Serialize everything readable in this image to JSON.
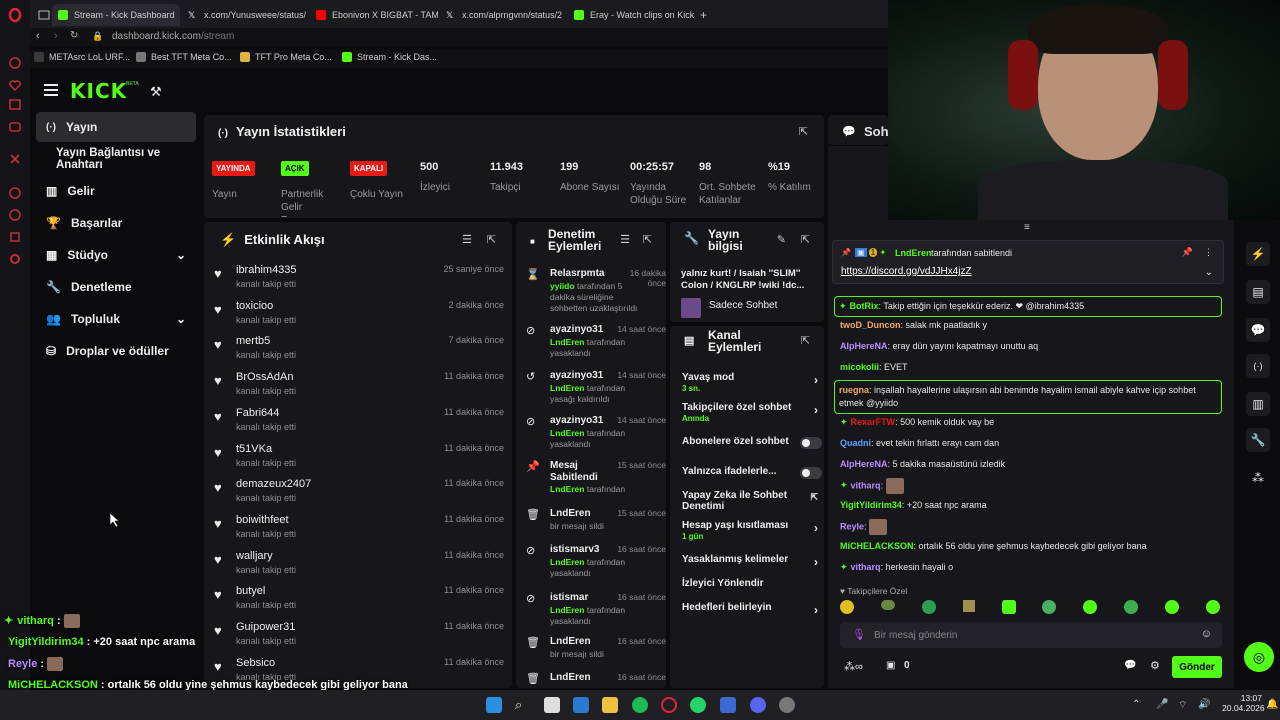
{
  "browser": {
    "tabs": [
      {
        "title": "Stream - Kick Dashboard",
        "color": "#53fc18"
      },
      {
        "title": "x.com/Yunusweee/status/",
        "color": "#ffffff"
      },
      {
        "title": "Ebonivon X BIGBAT - TAM",
        "color": "#ff0000"
      },
      {
        "title": "x.com/alprngvnn/status/2",
        "color": "#ffffff"
      },
      {
        "title": "Eray - Watch clips on Kick",
        "color": "#53fc18"
      }
    ],
    "url_host": "dashboard.kick.com",
    "url_path": "/stream",
    "bookmarks": [
      "METAsrc LoL URF...",
      "Best TFT Meta Co...",
      "TFT Pro Meta Co...",
      "Stream - Kick Das..."
    ]
  },
  "kick": {
    "logo": "KICK",
    "logo_sup": "BETA",
    "sidebar": [
      {
        "label": "Yayın",
        "icon": "broadcast-icon",
        "selected": true
      },
      {
        "label": "Yayın Bağlantısı ve Anahtarı",
        "icon": ""
      },
      {
        "label": "Gelir",
        "icon": "revenue-icon"
      },
      {
        "label": "Başarılar",
        "icon": "trophy-icon"
      },
      {
        "label": "Stüdyo",
        "icon": "studio-icon",
        "chevron": true
      },
      {
        "label": "Denetleme",
        "icon": "wrench-icon"
      },
      {
        "label": "Topluluk",
        "icon": "community-icon",
        "chevron": true
      },
      {
        "label": "Droplar ve ödüller",
        "icon": "drops-icon"
      }
    ]
  },
  "stats": {
    "title": "Yayın İstatistikleri",
    "items": [
      {
        "value": "YAYINDA",
        "label": "Yayın",
        "badge": "#e91916"
      },
      {
        "value": "AÇIK",
        "label": "Partnerlik Gelir Programı",
        "badge": "#53fc18"
      },
      {
        "value": "KAPALI",
        "label": "Çoklu Yayın",
        "badge": "#e91916"
      },
      {
        "value": "500",
        "label": "İzleyici"
      },
      {
        "value": "11.943",
        "label": "Takipçi"
      },
      {
        "value": "199",
        "label": "Abone Sayısı"
      },
      {
        "value": "00:25:57",
        "label": "Yayında Olduğu Süre"
      },
      {
        "value": "98",
        "label": "Ort. Sohbete Katılanlar"
      },
      {
        "value": "%19",
        "label": "% Katılım"
      }
    ]
  },
  "activity": {
    "title": "Etkinlik Akışı",
    "items": [
      {
        "name": "ibrahim4335",
        "sub": "kanalı takip etti",
        "time": "25 saniye önce"
      },
      {
        "name": "toxicioo",
        "sub": "kanalı takip etti",
        "time": "2 dakika önce"
      },
      {
        "name": "mertb5",
        "sub": "kanalı takip etti",
        "time": "7 dakika önce"
      },
      {
        "name": "BrOssAdAn",
        "sub": "kanalı takip etti",
        "time": "11 dakika önce"
      },
      {
        "name": "Fabri644",
        "sub": "kanalı takip etti",
        "time": "11 dakika önce"
      },
      {
        "name": "t51VKa",
        "sub": "kanalı takip etti",
        "time": "11 dakika önce"
      },
      {
        "name": "demazeux2407",
        "sub": "kanalı takip etti",
        "time": "11 dakika önce"
      },
      {
        "name": "boiwithfeet",
        "sub": "kanalı takip etti",
        "time": "11 dakika önce"
      },
      {
        "name": "walljary",
        "sub": "kanalı takip etti",
        "time": "11 dakika önce"
      },
      {
        "name": "butyel",
        "sub": "kanalı takip etti",
        "time": "11 dakika önce"
      },
      {
        "name": "Guipower31",
        "sub": "kanalı takip etti",
        "time": "11 dakika önce"
      },
      {
        "name": "Sebsico",
        "sub": "kanalı takip etti",
        "time": "11 dakika önce"
      }
    ]
  },
  "moderation": {
    "title": "Denetim Eylemleri",
    "items": [
      {
        "icon": "hourglass-icon",
        "name": "Relasrpmta",
        "time": "16 dakika önce",
        "desc_user": "yyiido",
        "desc": "tarafından 5 dakika süreliğine sohbetten uzaklaştırıldı"
      },
      {
        "icon": "ban-icon",
        "name": "ayazinyo31",
        "time": "14 saat önce",
        "desc_user": "LndEren",
        "desc": "tarafından yasaklandı"
      },
      {
        "icon": "undo-icon",
        "name": "ayazinyo31",
        "time": "14 saat önce",
        "desc_user": "LndEren",
        "desc": "tarafından yasağı kaldırıldı"
      },
      {
        "icon": "ban-icon",
        "name": "ayazinyo31",
        "time": "14 saat önce",
        "desc_user": "LndEren",
        "desc": "tarafından yasaklandı"
      },
      {
        "icon": "pin-icon",
        "name": "Mesaj Sabitlendi",
        "time": "15 saat önce",
        "desc_user": "LndEren",
        "desc": "tarafından"
      },
      {
        "icon": "trash-icon",
        "name": "LndEren",
        "time": "15 saat önce",
        "desc_user": "",
        "desc": "bir mesajı sildi"
      },
      {
        "icon": "ban-icon",
        "name": "istismarv3",
        "time": "16 saat önce",
        "desc_user": "LndEren",
        "desc": "tarafından yasaklandı"
      },
      {
        "icon": "ban-icon",
        "name": "istismar",
        "time": "16 saat önce",
        "desc_user": "LndEren",
        "desc": "tarafından yasaklandı"
      },
      {
        "icon": "trash-icon",
        "name": "LndEren",
        "time": "16 saat önce",
        "desc_user": "",
        "desc": "bir mesajı sildi"
      },
      {
        "icon": "trash-icon",
        "name": "LndEren",
        "time": "16 saat önce",
        "desc_user": "",
        "desc": ""
      }
    ]
  },
  "stream_info": {
    "title": "Yayın bilgisi",
    "stream_title": "yalnız kurt! / Isaiah ''SLIM'' Colon / KNGLRP !wiki !dc...",
    "chat_mode": "Sadece Sohbet"
  },
  "channel_actions": {
    "title": "Kanal Eylemleri",
    "items": [
      {
        "label": "Yavaş mod",
        "sub": "3 sn.",
        "control": "chevron"
      },
      {
        "label": "Takipçilere özel sohbet",
        "sub": "Anında",
        "control": "chevron"
      },
      {
        "label": "Abonelere özel sohbet",
        "sub": "",
        "control": "toggle"
      },
      {
        "label": "Yalnızca ifadelerle...",
        "sub": "",
        "control": "toggle"
      },
      {
        "label": "Yapay Zeka ile Sohbet Denetimi",
        "sub": "",
        "control": "external"
      },
      {
        "label": "Hesap yaşı kısıtlaması",
        "sub": "1 gün",
        "control": "chevron"
      },
      {
        "label": "Yasaklanmış kelimeler",
        "sub": "",
        "control": "chevron"
      },
      {
        "label": "İzleyici Yönlendir",
        "sub": "",
        "control": "none"
      },
      {
        "label": "Hedefleri belirleyin",
        "sub": "",
        "control": "chevron"
      }
    ]
  },
  "chat": {
    "title": "Soh",
    "pinned_by": "LndEren",
    "pinned_suffix": "tarafından sabitlendi",
    "pinned_link": "https://discord.gg/vdJJHx4jzZ",
    "messages": [
      {
        "user": "BotRix",
        "color": "#53fc18",
        "text": "Takip ettiğin için teşekkür ederiz. ❤ @ibrahim4335",
        "boxed": true
      },
      {
        "user": "twoD_Duncon",
        "color": "#f0a868",
        "text": "salak mk paatladık y"
      },
      {
        "user": "AlpHereNA",
        "color": "#b98cff",
        "text": "eray dün yayını kapatmayı unuttu aq"
      },
      {
        "user": "micokolii",
        "color": "#53fc18",
        "text": "EVET"
      },
      {
        "user": "ruegna",
        "color": "#f0a868",
        "text": "inşallah hayallerine ulaşırsın abi benimde hayalim ismail abiyle kahve içip sohbet etmek @yyiido",
        "boxed": true
      },
      {
        "user": "RexarFTW",
        "color": "#e91916",
        "text": "500 kemik olduk vay be"
      },
      {
        "user": "Quadni",
        "color": "#5aa0ff",
        "text": "evet tekin fırlattı erayı cam dan"
      },
      {
        "user": "AlpHereNA",
        "color": "#b98cff",
        "text": "5 dakika masaüstünü izledik"
      },
      {
        "user": "vitharq",
        "color": "#b98cff",
        "text": "[emote]"
      },
      {
        "user": "YigitYildirim34",
        "color": "#53fc18",
        "text": "+20 saat npc arama"
      },
      {
        "user": "Reyle",
        "color": "#b98cff",
        "text": "[emote]"
      },
      {
        "user": "MiCHELACKSON",
        "color": "#53fc18",
        "text": "ortalık 56 oldu yine şehmus kaybedecek gibi geliyor bana"
      },
      {
        "user": "vitharq",
        "color": "#b98cff",
        "text": "herkesin hayali o"
      }
    ],
    "followers_only": "Takipçilere Özel",
    "input_placeholder": "Bir mesaj gönderin",
    "points": "0",
    "send_label": "Gönder"
  },
  "overlay_chat": [
    {
      "user": "vitharq",
      "color": "#53fc18",
      "text": ""
    },
    {
      "user": "YigitYildirim34",
      "color": "#53fc18",
      "text": "+20 saat npc arama"
    },
    {
      "user": "Reyle",
      "color": "#b98cff",
      "text": ""
    },
    {
      "user": "MiCHELACKSON",
      "color": "#53fc18",
      "text": "ortalık 56 oldu yine şehmus kaybedecek gibi geliyor bana"
    },
    {
      "user": "vitharq",
      "color": "#53fc18",
      "text": "herkesin hayali o"
    }
  ],
  "taskbar": {
    "time": "13:07",
    "date": "20.04.2026"
  }
}
